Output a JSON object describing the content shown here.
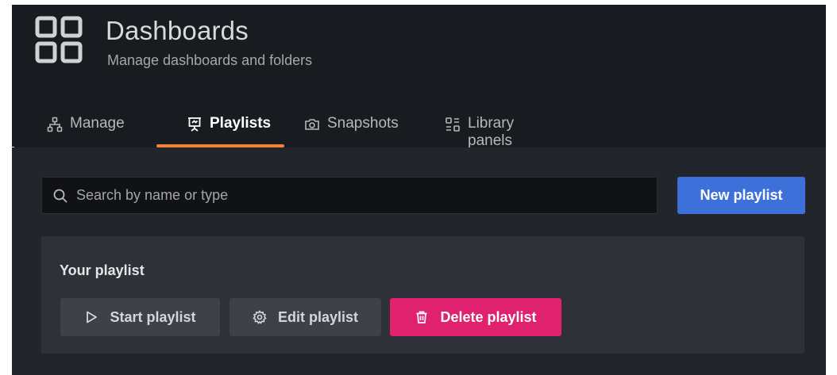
{
  "header": {
    "title": "Dashboards",
    "subtitle": "Manage dashboards and folders",
    "icon": "apps-grid-icon"
  },
  "tabs": [
    {
      "label": "Manage",
      "icon": "sitemap-icon",
      "active": false
    },
    {
      "label": "Playlists",
      "icon": "presentation-icon",
      "active": true
    },
    {
      "label": "Snapshots",
      "icon": "camera-icon",
      "active": false
    },
    {
      "label": "Library panels",
      "icon": "library-panels-icon",
      "active": false
    }
  ],
  "search": {
    "placeholder": "Search by name or type",
    "icon": "search-icon"
  },
  "new_playlist_label": "New playlist",
  "playlist": {
    "title": "Your playlist",
    "start_label": "Start playlist",
    "edit_label": "Edit playlist",
    "delete_label": "Delete playlist"
  },
  "colors": {
    "accent_tab": "#f0833a",
    "primary": "#3d71d9",
    "destructive": "#e0226e"
  }
}
